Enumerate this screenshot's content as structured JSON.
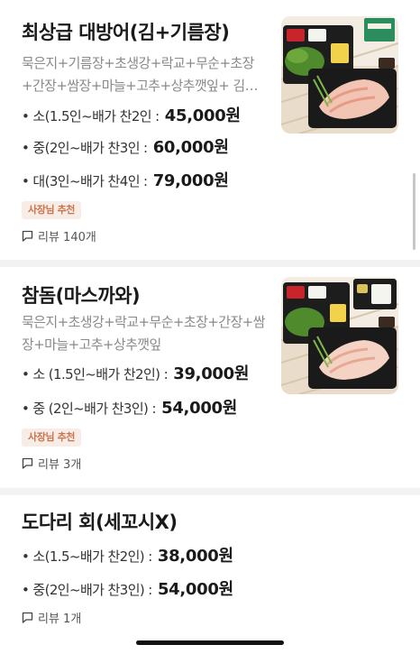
{
  "menu_items": [
    {
      "title": "최상급 대방어(김+기름장)",
      "description_lines": [
        "묵은지+기름장+초생강+락교+무순+초장",
        "+간장+쌈장+마늘+고추+상추깻잎+ 김+…"
      ],
      "options": [
        {
          "label": "• 소(1.5인~배가 찬2인 : ",
          "price": "45,000원"
        },
        {
          "label": "• 중(2인~배가 찬3인 : ",
          "price": "60,000원"
        },
        {
          "label": "• 대(3인~배가 찬4인 : ",
          "price": "79,000원"
        }
      ],
      "badge": "사장님 추천",
      "review": "리뷰 140개"
    },
    {
      "title": "참돔(마스까와)",
      "description_lines": [
        "묵은지+초생강+락교+무순+초장+간장+쌈",
        "장+마늘+고추+상추깻잎"
      ],
      "options": [
        {
          "label": "• 소 (1.5인~배가 찬2인) : ",
          "price": "39,000원"
        },
        {
          "label": "• 중 (2인~배가 찬3인) : ",
          "price": "54,000원"
        }
      ],
      "badge": "사장님 추천",
      "review": "리뷰 3개"
    },
    {
      "title": "도다리 회(세꼬시X)",
      "options": [
        {
          "label": "• 소(1.5~배가 찬2인) : ",
          "price": "38,000원"
        },
        {
          "label": "• 중(2인~배가 찬3인) : ",
          "price": "54,000원"
        }
      ],
      "review": "리뷰 1개"
    }
  ],
  "icons": {
    "review": "speech-bubble-icon",
    "thumbnail": "sashimi-platter-photo"
  }
}
